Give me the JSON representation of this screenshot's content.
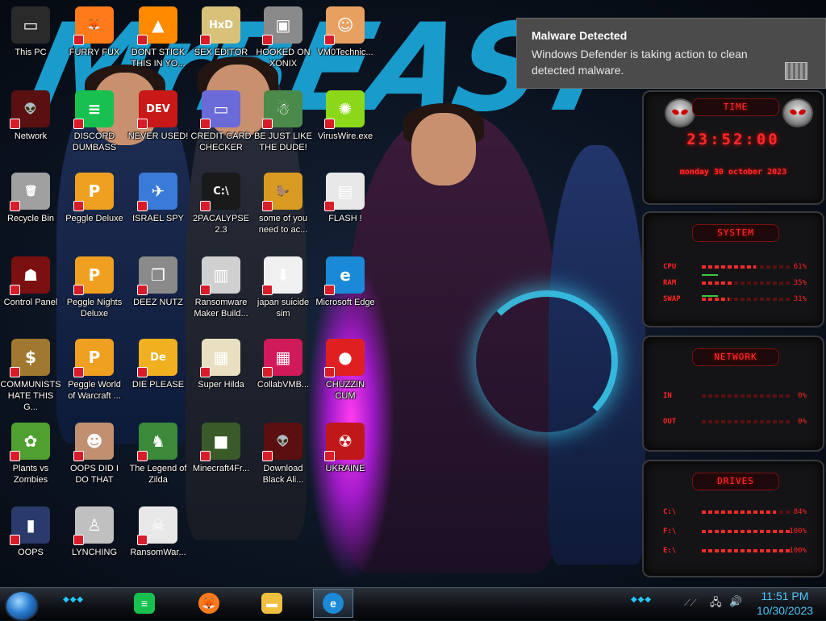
{
  "notification": {
    "title": "Malware Detected",
    "body": "Windows Defender is taking action to clean detected malware.",
    "icon": "defender-bars-icon"
  },
  "desktop_icons": [
    {
      "label": "This PC",
      "icon": "computer-icon",
      "color": "#2a2a2a"
    },
    {
      "label": "FURRY FUX",
      "icon": "firefox-icon",
      "color": "#ff7a1a"
    },
    {
      "label": "DONT STICK THIS IN YO...",
      "icon": "vlc-cone-icon",
      "color": "#ff8a00"
    },
    {
      "label": "SEX EDITOR",
      "icon": "hxd-icon",
      "color": "#d8c27a"
    },
    {
      "label": "HOOKED ON XONIX",
      "icon": "xonix-icon",
      "color": "#8a8a8a"
    },
    {
      "label": "VM0Technic...",
      "icon": "doctor-icon",
      "color": "#e8a060"
    },
    {
      "label": "Network",
      "icon": "alien-network-icon",
      "color": "#5a1010"
    },
    {
      "label": "DISCORD DUMBASS",
      "icon": "notes-icon",
      "color": "#18c050"
    },
    {
      "label": "NEVER USED!",
      "icon": "devcpp-icon",
      "color": "#c81818"
    },
    {
      "label": "CREDIT CARD CHECKER",
      "icon": "credit-card-icon",
      "color": "#6a6ad8"
    },
    {
      "label": "BE JUST LIKE THE DUDE!",
      "icon": "dwarf-icon",
      "color": "#4a8a4a"
    },
    {
      "label": "VirusWire.exe",
      "icon": "lime-icon",
      "color": "#8ad818"
    },
    {
      "label": "Recycle Bin",
      "icon": "recycle-bin-icon",
      "color": "#a0a0a0"
    },
    {
      "label": "Peggle Deluxe",
      "icon": "peggle-icon",
      "color": "#f0a020"
    },
    {
      "label": "ISRAEL SPY",
      "icon": "spy-icon",
      "color": "#3a7ad8"
    },
    {
      "label": "2PACALYPSE 2.3",
      "icon": "terminal-icon",
      "color": "#1a1a1a"
    },
    {
      "label": "some of you need to ac...",
      "icon": "beaver-icon",
      "color": "#d89a20"
    },
    {
      "label": "FLASH !",
      "icon": "flash-icon",
      "color": "#e8e8e8"
    },
    {
      "label": "Control Panel",
      "icon": "alien-control-icon",
      "color": "#7a1010"
    },
    {
      "label": "Peggle Nights Deluxe",
      "icon": "peggle-nights-icon",
      "color": "#f0a020"
    },
    {
      "label": "DEEZ NUTZ",
      "icon": "windows-stack-icon",
      "color": "#8a8a8a"
    },
    {
      "label": "Ransomware Maker Build...",
      "icon": "window-app-icon",
      "color": "#d0d0d0"
    },
    {
      "label": "japan suicide sim",
      "icon": "package-icon",
      "color": "#f0f0f0"
    },
    {
      "label": "Microsoft Edge",
      "icon": "edge-icon",
      "color": "#1a8ad8"
    },
    {
      "label": "COMMUNISTS HATE THIS G...",
      "icon": "money-bag-icon",
      "color": "#a07830"
    },
    {
      "label": "Peggle World of Warcraft ...",
      "icon": "peggle-wow-icon",
      "color": "#f0a020"
    },
    {
      "label": "DIE PLEASE",
      "icon": "de-icon",
      "color": "#f0b020"
    },
    {
      "label": "Super Hilda",
      "icon": "hilda-pixel-icon",
      "color": "#e8e0c0"
    },
    {
      "label": "CollabVMB...",
      "icon": "collab-monitor-icon",
      "color": "#d01a5a"
    },
    {
      "label": "CHUZZIN CUM",
      "icon": "chuzzle-icon",
      "color": "#e02020"
    },
    {
      "label": "Plants vs Zombies",
      "icon": "pvz-icon",
      "color": "#50a030"
    },
    {
      "label": "OOPS DID I DO THAT",
      "icon": "portrait-icon",
      "color": "#c09070"
    },
    {
      "label": "The Legend of Zilda",
      "icon": "zelda-pixel-icon",
      "color": "#3a8a3a"
    },
    {
      "label": "Minecraft4Fr...",
      "icon": "minecraft-block-icon",
      "color": "#3a5a2a"
    },
    {
      "label": "Download Black Ali...",
      "icon": "alien-download-icon",
      "color": "#5a1010"
    },
    {
      "label": "UKRAINE",
      "icon": "radiation-icon",
      "color": "#c01818"
    },
    {
      "label": "OOPS",
      "icon": "book-icon",
      "color": "#2a3a6a"
    },
    {
      "label": "LYNCHING",
      "icon": "lynch-icon",
      "color": "#c0c0c0"
    },
    {
      "label": "RansomWar...",
      "icon": "skull-icon",
      "color": "#e8e8e8"
    }
  ],
  "gadget": {
    "time_title": "TIME",
    "time": "23:52:00",
    "date": "monday 30 october 2023",
    "system_title": "SYSTEM",
    "system_rows": [
      {
        "label": "CPU",
        "value": "61%",
        "fill": 0.61
      },
      {
        "label": "RAM",
        "value": "35%",
        "fill": 0.35
      },
      {
        "label": "SWAP",
        "value": "31%",
        "fill": 0.31
      }
    ],
    "network_title": "NETWORK",
    "network_rows": [
      {
        "label": "IN",
        "value": "0%",
        "fill": 0
      },
      {
        "label": "OUT",
        "value": "0%",
        "fill": 0
      }
    ],
    "drives_title": "DRIVES",
    "drive_rows": [
      {
        "label": "C:\\",
        "value": "84%",
        "fill": 0.84
      },
      {
        "label": "F:\\",
        "value": "100%",
        "fill": 1.0
      },
      {
        "label": "E:\\",
        "value": "100%",
        "fill": 1.0
      }
    ],
    "accent_color": "#ff2424"
  },
  "taskbar": {
    "pinned": [
      {
        "name": "taskbar-notes-button",
        "icon": "notes-icon",
        "color": "#18c050"
      },
      {
        "name": "taskbar-firefox-button",
        "icon": "firefox-icon",
        "color": "#ff7a1a"
      },
      {
        "name": "taskbar-file-explorer-button",
        "icon": "folder-icon",
        "color": "#f0c040"
      },
      {
        "name": "taskbar-edge-button",
        "icon": "edge-icon",
        "color": "#1a8ad8"
      }
    ],
    "time": "11:51 PM",
    "date": "10/30/2023",
    "clock_color": "#4ec6ff"
  }
}
